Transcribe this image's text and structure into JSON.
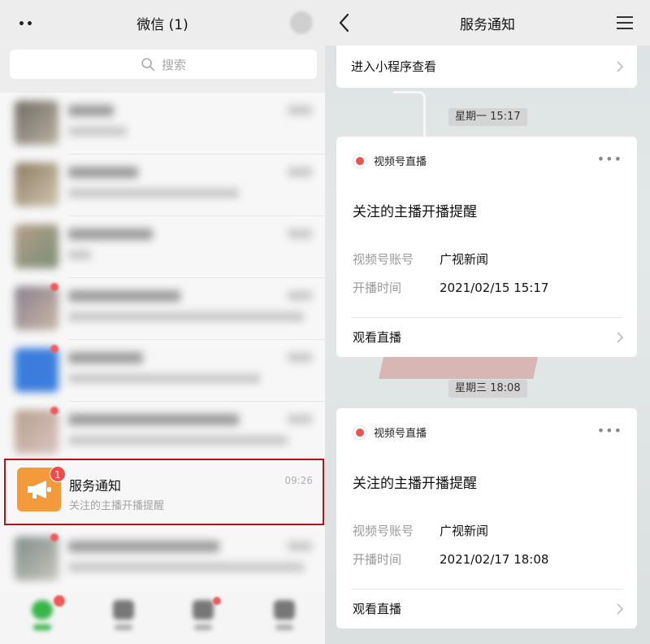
{
  "left": {
    "title": "微信 (1)",
    "menu_glyph": "••",
    "search_placeholder": "搜索",
    "service_chat": {
      "name": "服务通知",
      "preview": "关注的主播开播提醒",
      "time": "09:26",
      "badge": "1"
    }
  },
  "right": {
    "title": "服务通知",
    "top_link": "进入小程序查看",
    "notices": [
      {
        "timestamp": "星期一 15:17",
        "source": "视频号直播",
        "more": "•••",
        "heading": "关注的主播开播提醒",
        "account_label": "视频号账号",
        "account_value": "广视新闻",
        "time_label": "开播时间",
        "time_value": "2021/02/15 15:17",
        "action": "观看直播"
      },
      {
        "timestamp": "星期三 18:08",
        "source": "视频号直播",
        "more": "•••",
        "heading": "关注的主播开播提醒",
        "account_label": "视频号账号",
        "account_value": "广视新闻",
        "time_label": "开播时间",
        "time_value": "2021/02/17 18:08",
        "action": "观看直播"
      }
    ]
  },
  "colors": {
    "highlight_border": "#b3131d",
    "service_icon": "#f29a3c",
    "badge": "#f04b4b",
    "live_dot": "#e8554e"
  },
  "icons": {
    "search": "search-icon",
    "megaphone": "megaphone-icon",
    "back": "back-arrow-icon",
    "menu": "hamburger-menu-icon",
    "chevron": "chevron-right-icon",
    "live": "live-dot-icon"
  }
}
